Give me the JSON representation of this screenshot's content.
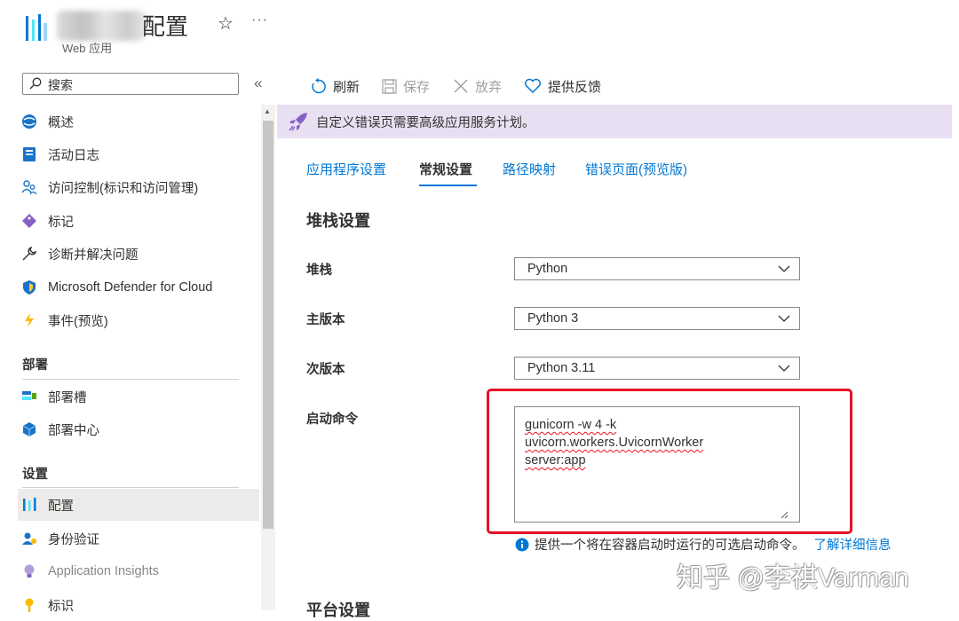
{
  "header": {
    "title": "配置",
    "subtitle": "Web 应用"
  },
  "sidebar": {
    "search_placeholder": "搜索",
    "items_top": [
      {
        "label": "概述",
        "icon": "globe-icon"
      },
      {
        "label": "活动日志",
        "icon": "log-icon"
      },
      {
        "label": "访问控制(标识和访问管理)",
        "icon": "people-icon"
      },
      {
        "label": "标记",
        "icon": "tag-icon"
      },
      {
        "label": "诊断并解决问题",
        "icon": "wrench-icon"
      },
      {
        "label": "Microsoft Defender for Cloud",
        "icon": "shield-icon"
      },
      {
        "label": "事件(预览)",
        "icon": "lightning-icon"
      }
    ],
    "section_deploy": "部署",
    "items_deploy": [
      {
        "label": "部署槽",
        "icon": "slots-icon"
      },
      {
        "label": "部署中心",
        "icon": "cube-icon"
      }
    ],
    "section_settings": "设置",
    "items_settings": [
      {
        "label": "配置",
        "icon": "config-icon",
        "selected": true
      },
      {
        "label": "身份验证",
        "icon": "auth-icon"
      },
      {
        "label": "Application Insights",
        "icon": "bulb-icon"
      },
      {
        "label": "标识",
        "icon": "key-icon"
      }
    ]
  },
  "toolbar": {
    "refresh": "刷新",
    "save": "保存",
    "discard": "放弃",
    "feedback": "提供反馈"
  },
  "banner": {
    "text": "自定义错误页需要高级应用服务计划。"
  },
  "tabs": [
    {
      "label": "应用程序设置",
      "active": false
    },
    {
      "label": "常规设置",
      "active": true
    },
    {
      "label": "路径映射",
      "active": false
    },
    {
      "label": "错误页面(预览版)",
      "active": false
    }
  ],
  "stack_settings": {
    "title": "堆栈设置",
    "stack_label": "堆栈",
    "stack_value": "Python",
    "major_label": "主版本",
    "major_value": "Python 3",
    "minor_label": "次版本",
    "minor_value": "Python 3.11",
    "startup_label": "启动命令",
    "startup_lines": [
      "gunicorn -w 4 -k",
      "uvicorn.workers.UvicornWorker",
      "server:app"
    ],
    "startup_info": "提供一个将在容器启动时运行的可选启动命令。",
    "learn_more": "了解详细信息"
  },
  "platform_title": "平台设置",
  "watermark": "知乎 @李祺Varman",
  "colors": {
    "accent": "#0078d4",
    "highlight": "#e81123",
    "banner_bg": "#e9dff3"
  }
}
